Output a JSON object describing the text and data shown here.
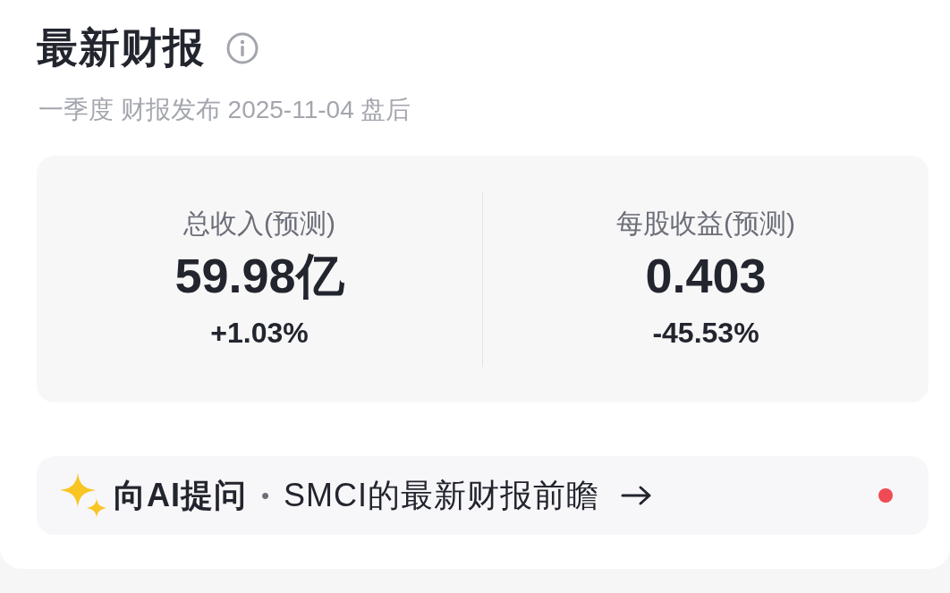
{
  "header": {
    "title": "最新财报",
    "subtitle": "一季度 财报发布 2025-11-04 盘后"
  },
  "metrics": [
    {
      "label": "总收入(预测)",
      "value": "59.98亿",
      "change": "+1.03%"
    },
    {
      "label": "每股收益(预测)",
      "value": "0.403",
      "change": "-45.53%"
    }
  ],
  "ai_prompt": {
    "label": "向AI提问",
    "separator": "•",
    "text": "SMCI的最新财报前瞻",
    "unread": true
  }
}
